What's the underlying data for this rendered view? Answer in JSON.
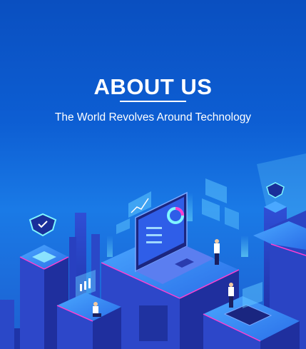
{
  "banner": {
    "title": "ABOUT US",
    "subtitle": "The World Revolves Around Technology"
  },
  "colors": {
    "background": "#0d5ed3",
    "accent_pink": "#ff3fd0",
    "accent_cyan": "#6ff0ff"
  },
  "illustration": {
    "icons": [
      "laptop-dashboard",
      "shield-icon",
      "chart-panel",
      "person-figures",
      "isometric-buildings"
    ]
  }
}
